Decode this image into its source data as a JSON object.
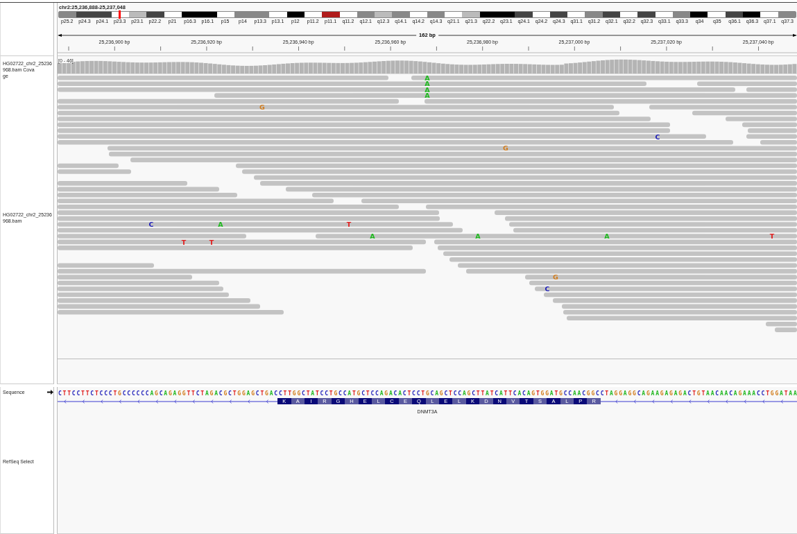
{
  "locus": "chr2:25,236,888-25,237,048",
  "ideogram": {
    "bands": [
      {
        "label": "p25.2",
        "color": "#888888",
        "selected": false
      },
      {
        "label": "p24.3",
        "color": "#444444",
        "selected": false
      },
      {
        "label": "p24.1",
        "color": "#444444",
        "selected": false
      },
      {
        "label": "p23.3",
        "color": "#ffffff",
        "selected": true
      },
      {
        "label": "p23.1",
        "color": "#bbbbbb",
        "selected": false
      },
      {
        "label": "p22.2",
        "color": "#444444",
        "selected": false
      },
      {
        "label": "p21",
        "color": "#ffffff",
        "selected": false
      },
      {
        "label": "p16.3",
        "color": "#000000",
        "selected": false
      },
      {
        "label": "p16.1",
        "color": "#000000",
        "selected": false
      },
      {
        "label": "p15",
        "color": "#ffffff",
        "selected": false
      },
      {
        "label": "p14",
        "color": "#888888",
        "selected": false
      },
      {
        "label": "p13.3",
        "color": "#888888",
        "selected": false
      },
      {
        "label": "p13.1",
        "color": "#ffffff",
        "selected": false
      },
      {
        "label": "p12",
        "color": "#000000",
        "selected": false
      },
      {
        "label": "p11.2",
        "color": "#ffffff",
        "selected": false
      },
      {
        "label": "p11.1",
        "color": "#b01c1c",
        "selected": false
      },
      {
        "label": "q11.2",
        "color": "#ffffff",
        "selected": false
      },
      {
        "label": "q12.1",
        "color": "#888888",
        "selected": false
      },
      {
        "label": "q12.3",
        "color": "#bbbbbb",
        "selected": false
      },
      {
        "label": "q14.1",
        "color": "#888888",
        "selected": false
      },
      {
        "label": "q14.2",
        "color": "#ffffff",
        "selected": false
      },
      {
        "label": "q14.3",
        "color": "#888888",
        "selected": false
      },
      {
        "label": "q21.1",
        "color": "#ffffff",
        "selected": false
      },
      {
        "label": "q21.3",
        "color": "#bbbbbb",
        "selected": false
      },
      {
        "label": "q22.2",
        "color": "#000000",
        "selected": false
      },
      {
        "label": "q23.1",
        "color": "#000000",
        "selected": false
      },
      {
        "label": "q24.1",
        "color": "#444444",
        "selected": false
      },
      {
        "label": "q24.2",
        "color": "#ffffff",
        "selected": false
      },
      {
        "label": "q24.3",
        "color": "#444444",
        "selected": false
      },
      {
        "label": "q31.1",
        "color": "#ffffff",
        "selected": false
      },
      {
        "label": "q31.2",
        "color": "#888888",
        "selected": false
      },
      {
        "label": "q32.1",
        "color": "#444444",
        "selected": false
      },
      {
        "label": "q32.2",
        "color": "#ffffff",
        "selected": false
      },
      {
        "label": "q32.3",
        "color": "#444444",
        "selected": false
      },
      {
        "label": "q33.1",
        "color": "#ffffff",
        "selected": false
      },
      {
        "label": "q33.3",
        "color": "#888888",
        "selected": false
      },
      {
        "label": "q34",
        "color": "#000000",
        "selected": false
      },
      {
        "label": "q35",
        "color": "#ffffff",
        "selected": false
      },
      {
        "label": "q36.1",
        "color": "#444444",
        "selected": false
      },
      {
        "label": "q36.3",
        "color": "#000000",
        "selected": false
      },
      {
        "label": "q37.1",
        "color": "#ffffff",
        "selected": false
      },
      {
        "label": "q37.3",
        "color": "#888888",
        "selected": false
      }
    ]
  },
  "ruler": {
    "span": "162 bp",
    "ticks": [
      "25,236,900 bp",
      "25,236,920 bp",
      "25,236,940 bp",
      "25,236,960 bp",
      "25,236,980 bp",
      "25,237,000 bp",
      "25,237,020 bp",
      "25,237,040 bp"
    ]
  },
  "coverage_track": {
    "label_lines": [
      "HG02722_chr2_25236968.bam Cova",
      "ge"
    ],
    "range": "[0 - 46]"
  },
  "alignment_track": {
    "label": "HG02722_chr2_25236968.bam",
    "mismatches": [
      {
        "base": "A",
        "color": "#22b822"
      },
      {
        "base": "A",
        "color": "#22b822"
      },
      {
        "base": "A",
        "color": "#22b822"
      },
      {
        "base": "A",
        "color": "#22b822"
      },
      {
        "base": "G",
        "color": "#d17c1c"
      },
      {
        "base": "C",
        "color": "#1a1ab8"
      },
      {
        "base": "G",
        "color": "#d17c1c"
      },
      {
        "base": "C",
        "color": "#1a1ab8"
      },
      {
        "base": "A",
        "color": "#22b822"
      },
      {
        "base": "T",
        "color": "#e01e1e"
      },
      {
        "base": "A",
        "color": "#22b822"
      },
      {
        "base": "A",
        "color": "#22b822"
      },
      {
        "base": "A",
        "color": "#22b822"
      },
      {
        "base": "T",
        "color": "#e01e1e"
      },
      {
        "base": "T",
        "color": "#e01e1e"
      },
      {
        "base": "T",
        "color": "#e01e1e"
      },
      {
        "base": "G",
        "color": "#d17c1c"
      },
      {
        "base": "C",
        "color": "#1a1ab8"
      }
    ]
  },
  "sequence_track": {
    "label": "Sequence",
    "sequence": "CTTCCTTCTCCCTGCCCCCCAGCAGAGGTTCTAGACGCTGGAGCTGACCTTGGCTATCCTGCCATGCTCCAGACACTCCTGCAGCTCCAGCTTATCATTCACAGTGGATGCCAACGGCCTAGGAGGCAGAAGAGAGACTGTAACAACAGAAACCTGGATAA"
  },
  "gene_track": {
    "label": "RefSeq Select",
    "gene": "DNMT3A",
    "amino_acids": [
      "K",
      "A",
      "I",
      "R",
      "G",
      "H",
      "E",
      "L",
      "C",
      "E",
      "Q",
      "L",
      "E",
      "L",
      "K",
      "D",
      "N",
      "V",
      "T",
      "S",
      "A",
      "L",
      "P",
      "R"
    ]
  }
}
